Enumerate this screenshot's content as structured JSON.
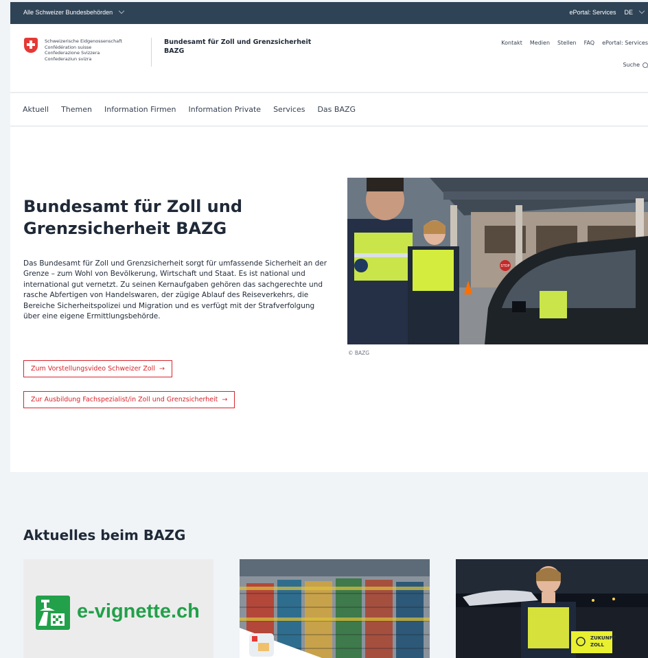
{
  "topbar": {
    "authorities_label": "Alle Schweizer Bundesbehörden",
    "eportal_label": "ePortal: Services",
    "language": "DE"
  },
  "header": {
    "confederation_lines": [
      "Schweizerische Eidgenossenschaft",
      "Confédération suisse",
      "Confederazione Svizzera",
      "Confederaziun svizra"
    ],
    "agency_name": "Bundesamt für Zoll und Grenzsicherheit",
    "agency_abbr": "BAZG",
    "meta_nav": [
      "Kontakt",
      "Medien",
      "Stellen",
      "FAQ",
      "ePortal: Services"
    ],
    "search_label": "Suche"
  },
  "main_nav": [
    "Aktuell",
    "Themen",
    "Information Firmen",
    "Information Private",
    "Services",
    "Das BAZG"
  ],
  "hero": {
    "title": "Bundesamt für Zoll und Grenzsicherheit BAZG",
    "text": "Das Bundesamt für Zoll und Grenzsicherheit sorgt für umfassende Sicherheit an der Grenze – zum Wohl von Bevölkerung, Wirtschaft und Staat. Es ist national und international gut vernetzt. Zu seinen Kernaufgaben gehören das sachgerechte und rasche Abfertigen von Handelswaren, der zügige Ablauf des Reiseverkehrs, die Bereiche Sicherheitspolizei und Migration und es verfügt mit der Strafverfolgung über eine eigene Ermittlungsbehörde.",
    "cta_video": "Zum Vorstellungsvideo Schweizer Zoll",
    "cta_training": "Zur Ausbildung Fachspezialist/in Zoll und Grenzsicherheit",
    "photo_credit": "© BAZG",
    "stop_sign": "STOP"
  },
  "news": {
    "title": "Aktuelles beim BAZG",
    "card1_logo_text": "e-vignette.ch",
    "card3_badge": [
      "ZUKUNFT",
      "ZOLL"
    ]
  },
  "colors": {
    "topbar": "#2f4356",
    "swiss_red": "#e53935",
    "link_red": "#d8232a",
    "vignette_green": "#22a04a"
  }
}
